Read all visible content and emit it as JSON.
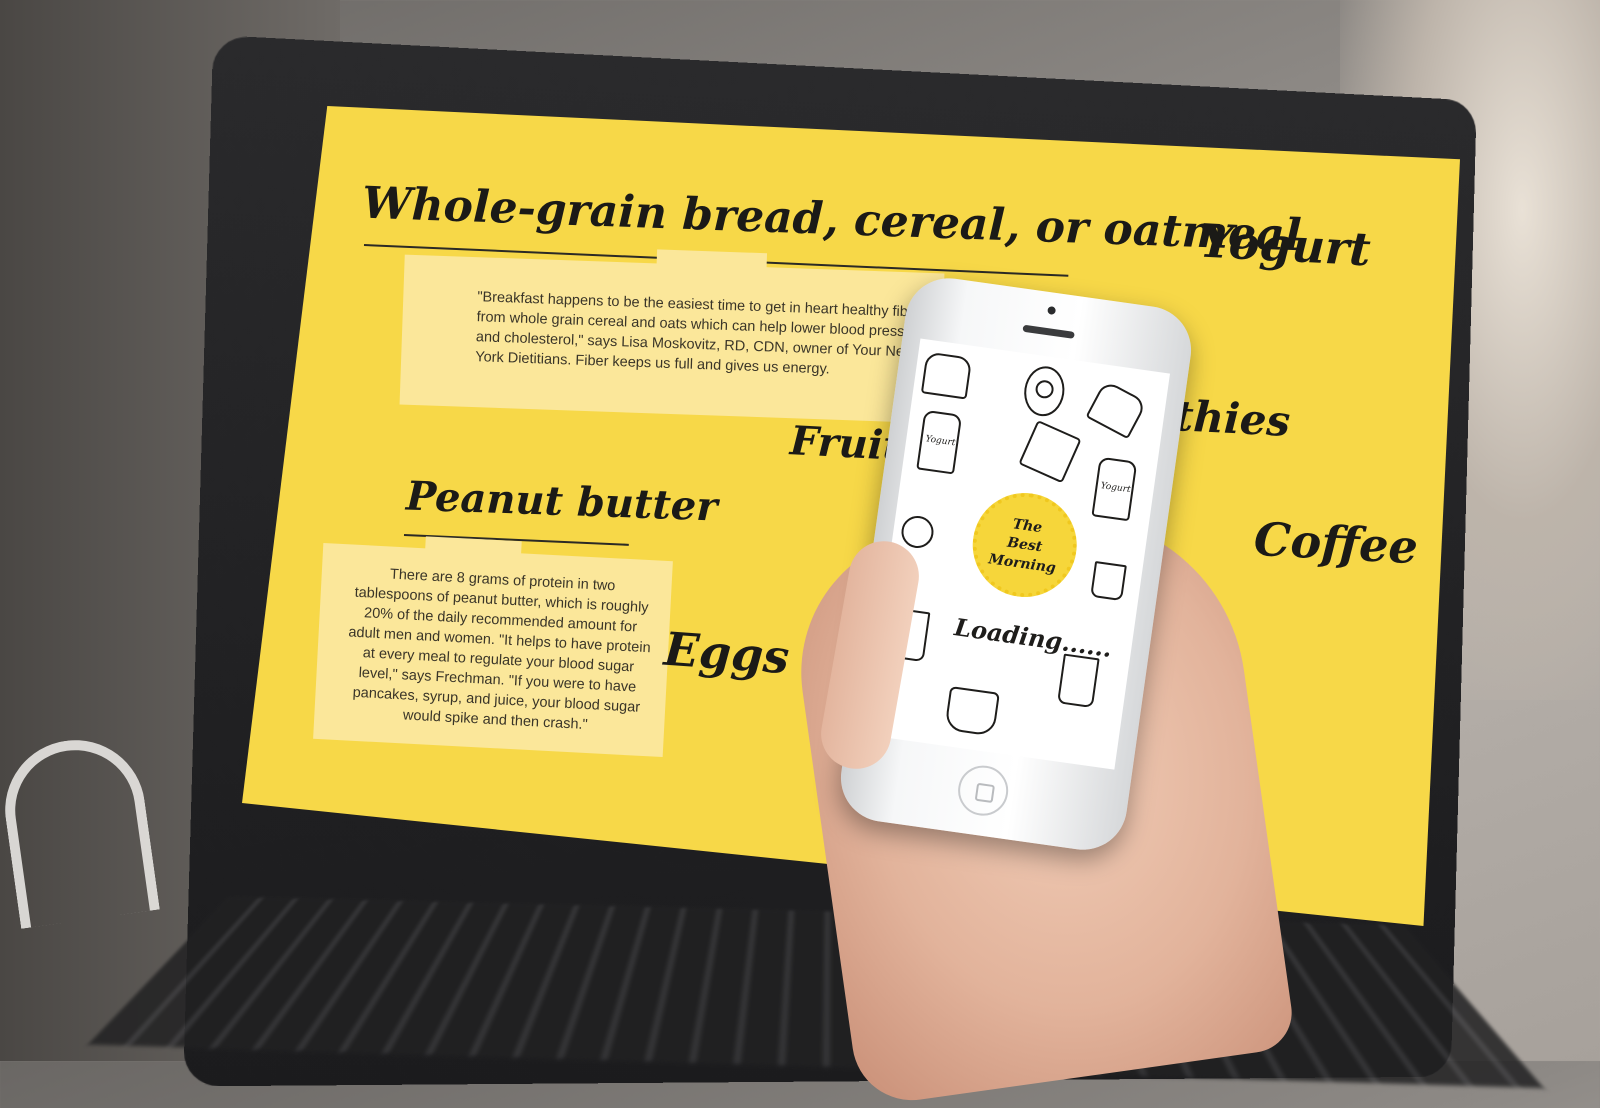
{
  "laptop": {
    "headings": {
      "whole_grain": "Whole-grain bread, cereal, or oatmeal",
      "peanut_butter": "Peanut butter",
      "fruit": "Fruit",
      "eggs": "Eggs",
      "yogurt": "Yogurt",
      "smoothies": "thies",
      "coffee": "Coffee"
    },
    "cards": {
      "oatmeal_text": "\"Breakfast happens to be the easiest time to get in heart healthy fiber from whole grain cereal and oats which can help lower blood pressure and cholesterol,\" says Lisa Moskovitz, RD, CDN, owner of Your New York Dietitians. Fiber keeps us full and gives us energy.",
      "peanut_text": "There are 8 grams of protein in two tablespoons of peanut butter, which is roughly 20% of the daily recommended amount for adult men and women. \"It helps to have protein at every meal to regulate your blood sugar level,\" says Frechman. \"If you were to have pancakes, syrup, and juice, your blood sugar would spike and then crash.\""
    },
    "colors": {
      "screen_bg": "#f7d848",
      "card_bg": "#fbe79a",
      "ink": "#1b1a17"
    }
  },
  "phone": {
    "badge_lines": [
      "The",
      "Best",
      "Morning"
    ],
    "loading_text": "Loading......",
    "doodle_labels": [
      "Yogurt",
      "Yogurt"
    ],
    "icons": [
      "toast-icon",
      "egg-icon",
      "cracker-icon",
      "milk-bottle-icon",
      "juice-cup-icon",
      "cereal-bowl-icon",
      "mug-icon",
      "plate-icon"
    ],
    "colors": {
      "badge": "#f6d63a",
      "screen_bg": "#ffffff"
    }
  }
}
